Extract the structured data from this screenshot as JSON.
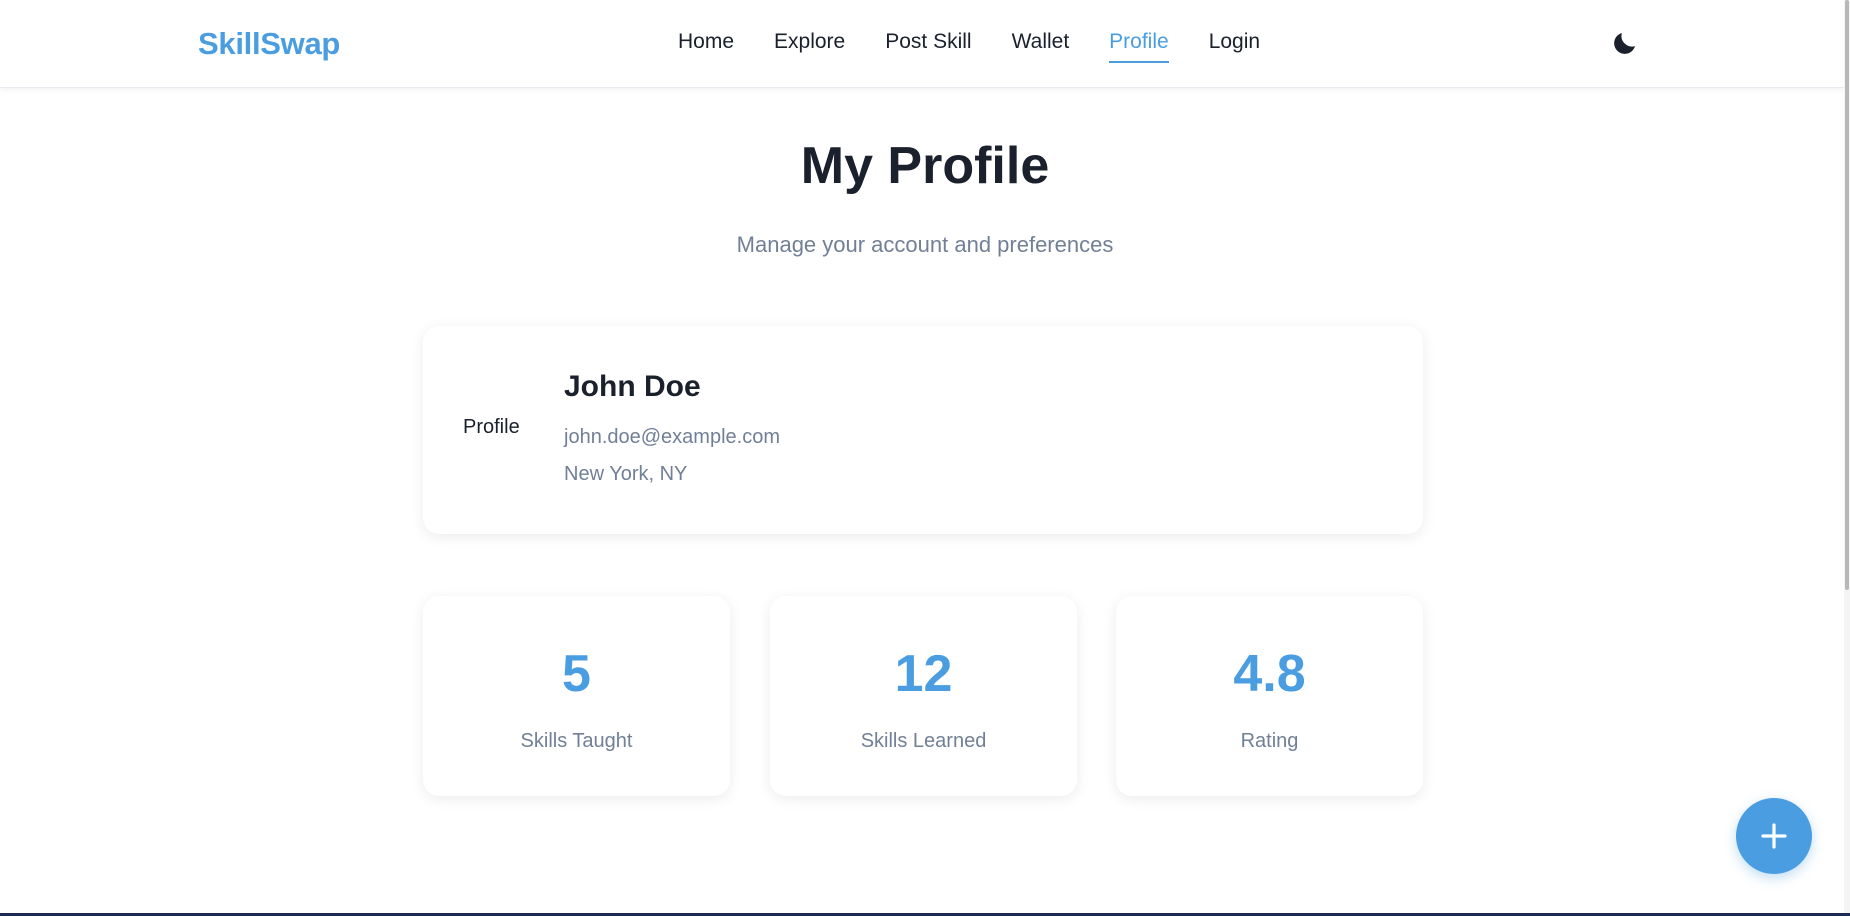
{
  "brand": "SkillSwap",
  "nav": {
    "items": [
      {
        "label": "Home",
        "active": false
      },
      {
        "label": "Explore",
        "active": false
      },
      {
        "label": "Post Skill",
        "active": false
      },
      {
        "label": "Wallet",
        "active": false
      },
      {
        "label": "Profile",
        "active": true
      },
      {
        "label": "Login",
        "active": false
      }
    ],
    "theme_toggle_icon": "moon-icon"
  },
  "header": {
    "title": "My Profile",
    "subtitle": "Manage your account and preferences"
  },
  "profile": {
    "avatar_alt": "Profile",
    "name": "John Doe",
    "email": "john.doe@example.com",
    "location": "New York, NY"
  },
  "stats": [
    {
      "value": "5",
      "label": "Skills Taught"
    },
    {
      "value": "12",
      "label": "Skills Learned"
    },
    {
      "value": "4.8",
      "label": "Rating"
    }
  ],
  "fab": {
    "icon": "plus-icon"
  },
  "colors": {
    "accent": "#4a9de0",
    "text_primary": "#1a202c",
    "text_muted": "#718096"
  }
}
